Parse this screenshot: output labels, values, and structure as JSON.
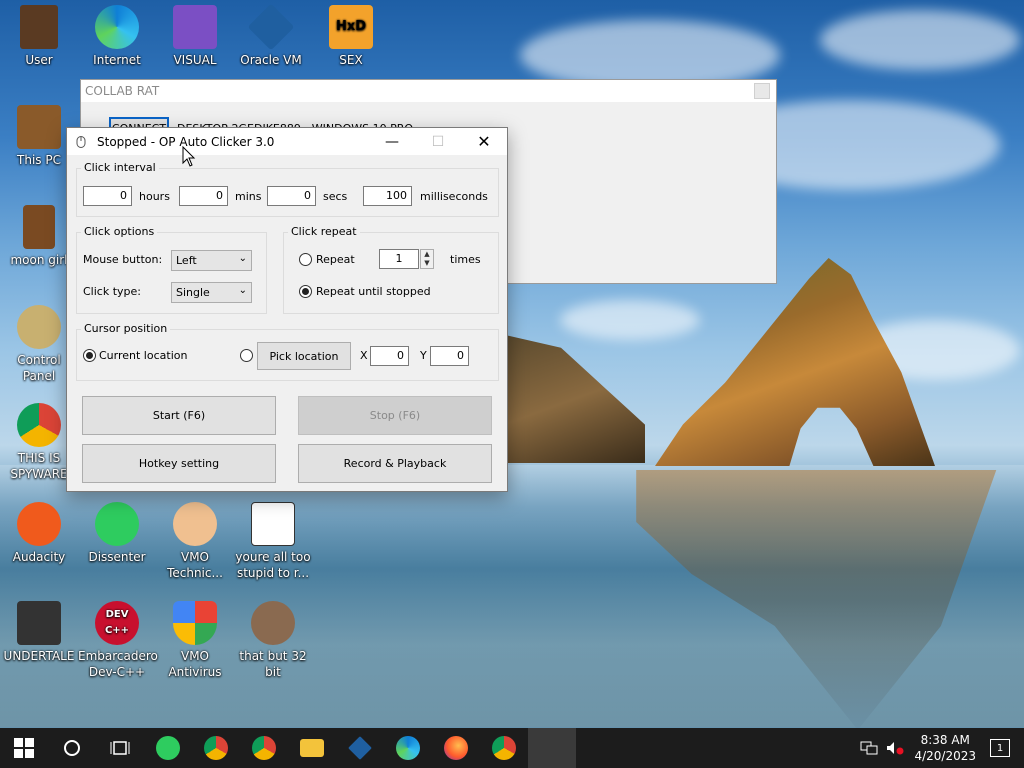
{
  "desktop": {
    "icons": [
      {
        "label": "User"
      },
      {
        "label": "Internet"
      },
      {
        "label": "VISUAL"
      },
      {
        "label": "Oracle VM"
      },
      {
        "label": "SEX"
      },
      {
        "label": "This PC"
      },
      {
        "label": "moon girl"
      },
      {
        "label": "Control Panel"
      },
      {
        "label": "THIS IS SPYWARE"
      },
      {
        "label": "Audacity"
      },
      {
        "label": "Dissenter"
      },
      {
        "label": "VMO Technic..."
      },
      {
        "label": "youre all too stupid to r..."
      },
      {
        "label": "UNDERTALE"
      },
      {
        "label": "Embarcadero Dev-C++"
      },
      {
        "label": "VMO Antivirus"
      },
      {
        "label": "that but 32 bit"
      }
    ],
    "icon_glyphs": {
      "hxd": "HxD",
      "devcpp": "DEV C++"
    }
  },
  "back_window": {
    "title": "COLLAB RAT",
    "connect_label": "CONNECT",
    "host_text": "DESKTOP-2GEDJKE889 - WINDOWS 10 PRO"
  },
  "window": {
    "title": "Stopped - OP Auto Clicker 3.0",
    "min_glyph": "—",
    "max_glyph": "☐",
    "close_glyph": "✕",
    "click_interval": {
      "legend": "Click interval",
      "hours_value": "0",
      "hours_label": "hours",
      "mins_value": "0",
      "mins_label": "mins",
      "secs_value": "0",
      "secs_label": "secs",
      "ms_value": "100",
      "ms_label": "milliseconds"
    },
    "click_options": {
      "legend": "Click options",
      "mouse_button_label": "Mouse button:",
      "mouse_button_value": "Left",
      "click_type_label": "Click type:",
      "click_type_value": "Single"
    },
    "click_repeat": {
      "legend": "Click repeat",
      "repeat_label": "Repeat",
      "repeat_value": "1",
      "times_label": "times",
      "until_stopped_label": "Repeat until stopped",
      "selected": "until_stopped"
    },
    "cursor_position": {
      "legend": "Cursor position",
      "current_location_label": "Current location",
      "pick_location_label": "Pick location",
      "x_label": "X",
      "x_value": "0",
      "y_label": "Y",
      "y_value": "0",
      "selected": "current"
    },
    "buttons": {
      "start": "Start (F6)",
      "stop": "Stop (F6)",
      "hotkey": "Hotkey setting",
      "record": "Record & Playback"
    }
  },
  "taskbar": {
    "time": "8:38 AM",
    "date": "4/20/2023",
    "notification_count": "1"
  },
  "colors": {
    "taskbar": "#1c1c1c",
    "window_bg": "#f0f0f0",
    "accent_blue": "#0a64c8"
  }
}
